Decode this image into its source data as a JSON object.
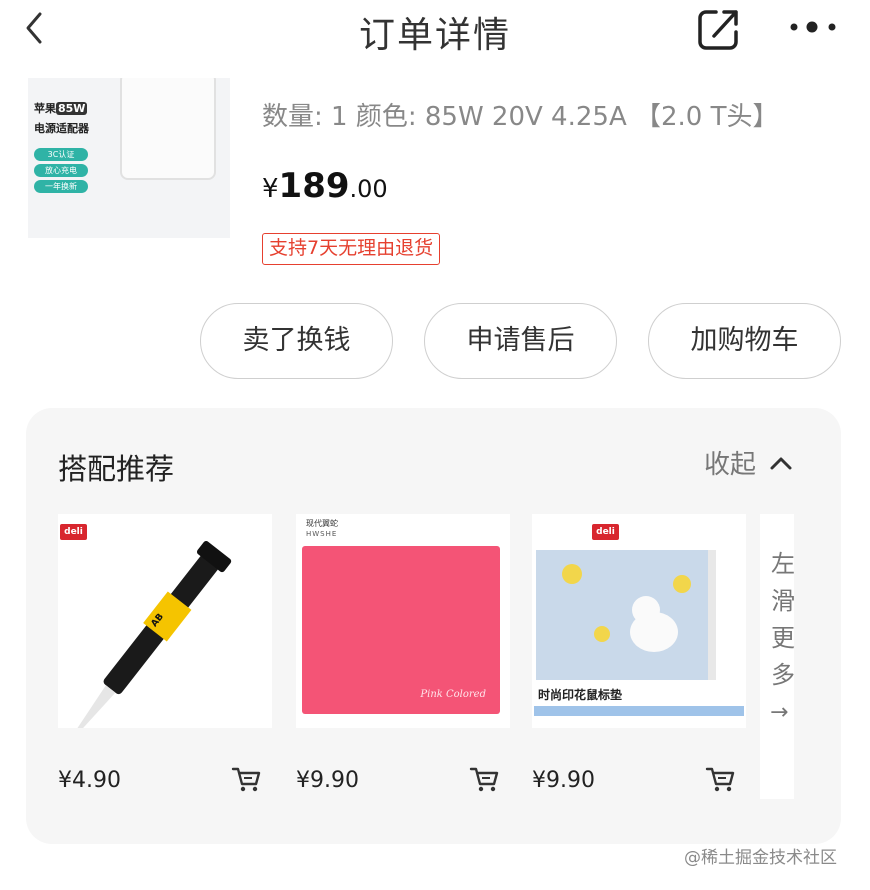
{
  "nav": {
    "title": "订单详情",
    "back_icon": "chevron-left-icon",
    "share_icon": "share-icon",
    "more_icon": "more-dots-icon"
  },
  "order_item": {
    "thumb_label_prefix": "苹果",
    "thumb_label_watt": "85W",
    "thumb_label_line2": "电源适配器",
    "thumb_tags": [
      "3C认证",
      "放心充电",
      "一年换新"
    ],
    "spec": "数量: 1  颜色: 85W 20V 4.25A 【2.0 T头】",
    "price_currency": "¥",
    "price_int": "189",
    "price_dec": ".00",
    "refund_badge": "支持7天无理由退货"
  },
  "actions": {
    "sell": "卖了换钱",
    "after_sale": "申请售后",
    "add_cart": "加购物车"
  },
  "recommend": {
    "title": "搭配推荐",
    "collapse_label": "收起",
    "items": [
      {
        "price": "¥4.90",
        "brand": "deli",
        "image": "ab-glue-syringe"
      },
      {
        "price": "¥9.90",
        "caption": "现代翼蛇",
        "caption2": "HWSHE",
        "brand_text": "Pink Colored",
        "image": "pink-mouse-pad"
      },
      {
        "price": "¥9.90",
        "brand": "deli",
        "caption": "时尚印花鼠标垫",
        "image": "cat-print-mouse-pad"
      }
    ],
    "more_text": "左滑更多",
    "more_arrow": "→"
  },
  "watermark": "@稀土掘金技术社区",
  "colors": {
    "accent_red": "#e6402f",
    "deli_red": "#d8262e",
    "pad_pink": "#f45476"
  }
}
